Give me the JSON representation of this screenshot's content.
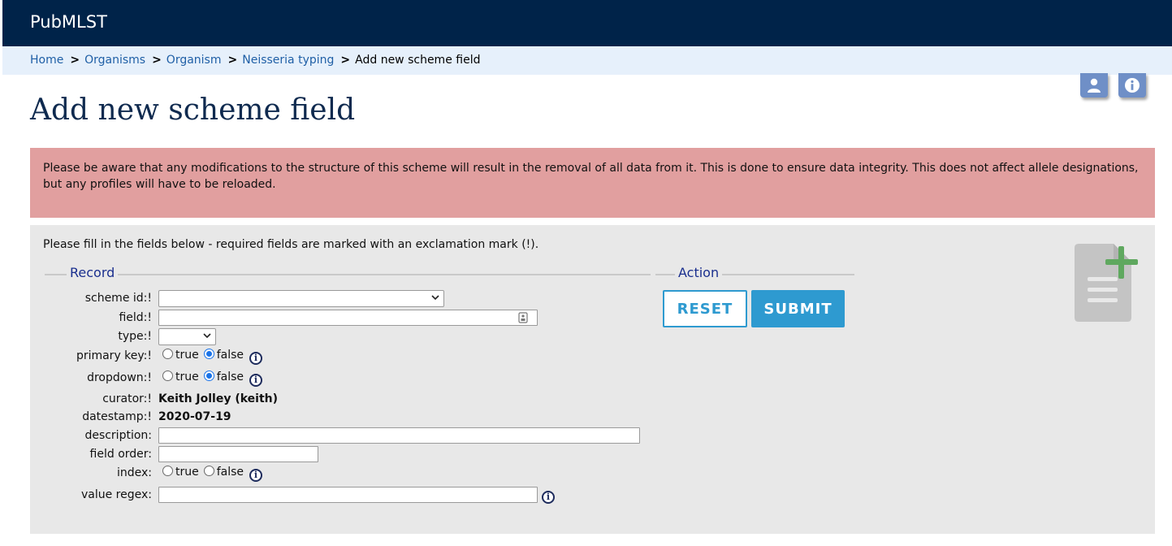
{
  "site": {
    "title": "PubMLST"
  },
  "breadcrumb": [
    {
      "label": "Home",
      "link": true
    },
    {
      "label": "Organisms",
      "link": true
    },
    {
      "label": "Organism",
      "link": true
    },
    {
      "label": "Neisseria typing",
      "link": true
    },
    {
      "label": "Add new scheme field",
      "link": false
    }
  ],
  "breadcrumb_separator": ">",
  "header_icons": [
    "user-icon",
    "info-icon"
  ],
  "page": {
    "title": "Add new scheme field"
  },
  "warning": {
    "text": "Please be aware that any modifications to the structure of this scheme will result in the removal of all data from it. This is done to ensure data integrity. This does not affect allele designations, but any profiles will have to be reloaded."
  },
  "form": {
    "instructions": "Please fill in the fields below - required fields are marked with an exclamation mark (!).",
    "record_legend": "Record",
    "action_legend": "Action",
    "fields": {
      "scheme_id": {
        "label": "scheme id:!",
        "value": ""
      },
      "field": {
        "label": "field:!",
        "value": ""
      },
      "type": {
        "label": "type:!",
        "value": ""
      },
      "primary_key": {
        "label": "primary key:!",
        "options": [
          "true",
          "false"
        ],
        "selected": "false"
      },
      "dropdown": {
        "label": "dropdown:!",
        "options": [
          "true",
          "false"
        ],
        "selected": "false"
      },
      "curator": {
        "label": "curator:!",
        "value": "Keith Jolley (keith)"
      },
      "datestamp": {
        "label": "datestamp:!",
        "value": "2020-07-19"
      },
      "description": {
        "label": "description:",
        "value": ""
      },
      "field_order": {
        "label": "field order:",
        "value": ""
      },
      "index": {
        "label": "index:",
        "options": [
          "true",
          "false"
        ],
        "selected": ""
      },
      "value_regex": {
        "label": "value regex:",
        "value": ""
      }
    },
    "buttons": {
      "reset": "RESET",
      "submit": "SUBMIT"
    },
    "info_icon_glyph": "i"
  },
  "colors": {
    "topbar": "#002349",
    "breadcrumb_bg": "#e6f0fb",
    "warning_bg": "#e19f9f",
    "panel_bg": "#e8e8e8",
    "accent": "#2e9ad0"
  }
}
